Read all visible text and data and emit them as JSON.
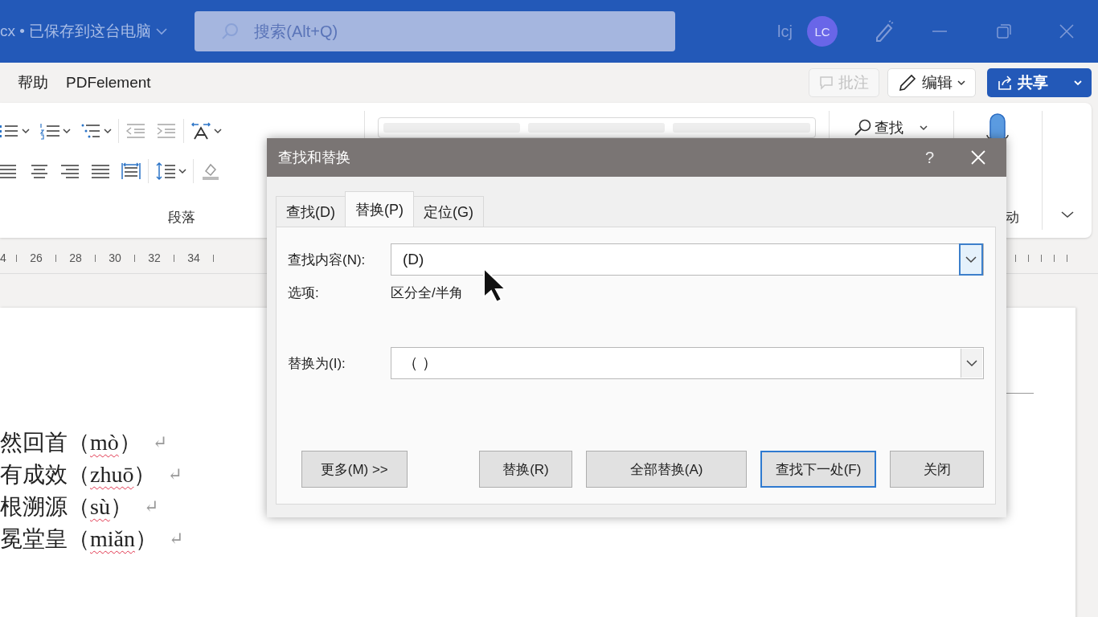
{
  "title_bar": {
    "document_status": "cx • 已保存到这台电脑",
    "search_placeholder": "搜索(Alt+Q)",
    "user_name": "lcj",
    "avatar_initials": "LC"
  },
  "menu": {
    "tabs": [
      {
        "label": "帮助",
        "selected": false
      },
      {
        "label": "PDFelement",
        "selected": false
      }
    ],
    "comment_button": {
      "label": "批注",
      "disabled": true
    },
    "edit_button": {
      "label": "编辑"
    },
    "share_button": {
      "label": "共享"
    }
  },
  "ribbon": {
    "group_label": "段落",
    "find_button": "查找",
    "dictate_label": "动"
  },
  "ruler": {
    "numbers": [
      "4",
      "26",
      "28",
      "30",
      "32",
      "34"
    ]
  },
  "document": {
    "lines": [
      {
        "text_before": "然回首（",
        "misspelled": "mò",
        "text_after": "）",
        "mark": "↵"
      },
      {
        "text_before": "有成效（",
        "misspelled": "zhuō",
        "text_after": "）",
        "mark": "↵"
      },
      {
        "text_before": "根溯源（",
        "misspelled": "sù",
        "text_after": "）",
        "mark": "↵"
      },
      {
        "text_before": "冕堂皇（",
        "misspelled": "miǎn",
        "text_after": "）",
        "mark": "↵"
      }
    ]
  },
  "dialog": {
    "title": "查找和替换",
    "help": "?",
    "tabs": [
      {
        "label": "查找(D)",
        "selected": false
      },
      {
        "label": "替换(P)",
        "selected": true
      },
      {
        "label": "定位(G)",
        "selected": false
      }
    ],
    "find_label": "查找内容(N):",
    "find_value": "(D)",
    "find_focused": true,
    "options_label": "选项:",
    "options_value": "区分全/半角",
    "replace_label": "替换为(I):",
    "replace_value": "（ ）",
    "replace_focused": false,
    "buttons": [
      {
        "label": "更多(M) >>",
        "default": false
      },
      {
        "label": "替换(R)",
        "default": false
      },
      {
        "label": "全部替换(A)",
        "default": false
      },
      {
        "label": "查找下一处(F)",
        "default": true
      },
      {
        "label": "关闭",
        "default": false
      }
    ]
  }
}
